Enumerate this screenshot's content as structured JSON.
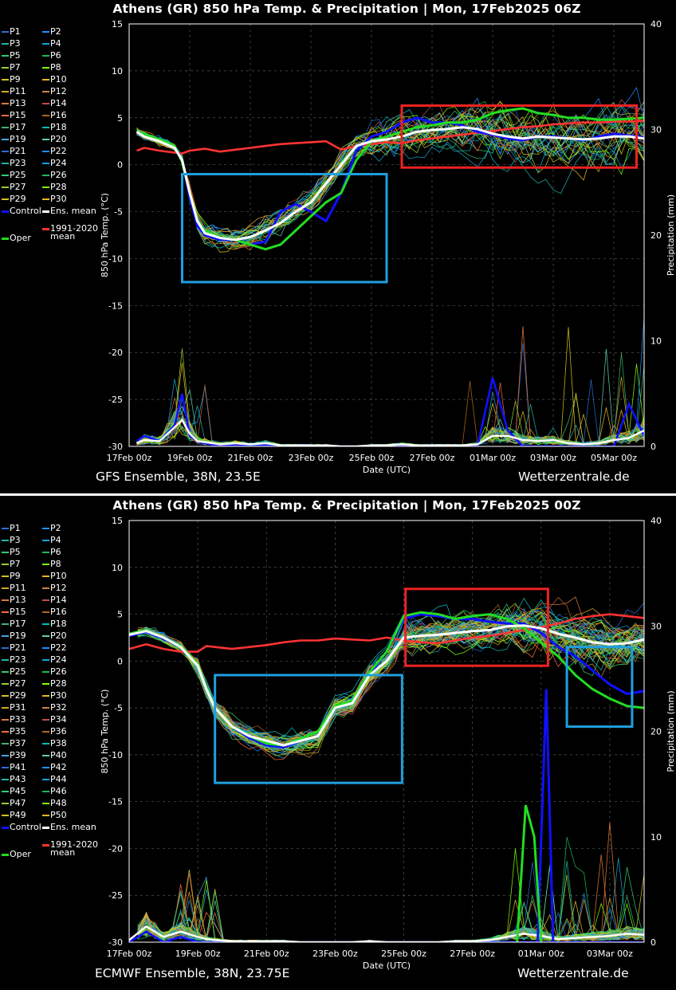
{
  "colors": {
    "control": "#1010ff",
    "ens_mean": "#ffffff",
    "oper": "#22dd22",
    "climate": "#ff3333",
    "box_warm": "#ee2222",
    "box_cold": "#1f9fdf",
    "member_palette": [
      "#2b6cd6",
      "#1e90ff",
      "#20b2aa",
      "#11a5d8",
      "#2ecc71",
      "#1db954",
      "#9acd32",
      "#7fff00",
      "#d4c21a",
      "#e8b520",
      "#daa520",
      "#cd853f",
      "#e07b39",
      "#c0504d",
      "#ff6a3d",
      "#b5651d",
      "#3cb371",
      "#00bfbf",
      "#48a4e0",
      "#66cdaa"
    ]
  },
  "panels": [
    {
      "title": "Athens  (GR)  850 hPa Temp. & Precipitation | Mon, 17Feb2025 06Z",
      "footer_left": "GFS Ensemble, 38N, 23.5E",
      "footer_right": "Wetterzentrale.de",
      "legend": {
        "members": [
          "P1",
          "P2",
          "P3",
          "P4",
          "P5",
          "P6",
          "P7",
          "P8",
          "P9",
          "P10",
          "P11",
          "P12",
          "P13",
          "P14",
          "P15",
          "P16",
          "P17",
          "P18",
          "P19",
          "P20",
          "P21",
          "P22",
          "P23",
          "P24",
          "P25",
          "P26",
          "P27",
          "P28",
          "P29",
          "P30"
        ],
        "control": "Control",
        "ens_mean": "Ens. mean",
        "climate": "1991-2020",
        "climate_2": "mean",
        "oper": "Oper"
      },
      "chart_data": {
        "type": "line",
        "xlabel": "Date (UTC)",
        "ylabel": "850 hPa Temp. (°C)",
        "ylabel_right": "Precipitation (mm)",
        "ylim": [
          -30,
          15
        ],
        "ylim_right": [
          0,
          40
        ],
        "yticks": [
          "15",
          "10",
          "5",
          "0",
          "-5",
          "-10",
          "-15",
          "-20",
          "-25",
          "-30"
        ],
        "yticks_right": [
          "40",
          "30",
          "20",
          "10",
          "0"
        ],
        "xticks": [
          "17Feb 00z",
          "19Feb 00z",
          "21Feb 00z",
          "23Feb 00z",
          "25Feb 00z",
          "27Feb 00z",
          "01Mar 00z",
          "03Mar 00z",
          "05Mar 00z"
        ],
        "xrange_days": [
          0,
          17
        ],
        "members_count": 30,
        "t_days": [
          0.25,
          0.5,
          1,
          1.5,
          1.75,
          2,
          2.25,
          2.5,
          3,
          3.5,
          4,
          4.5,
          5,
          5.5,
          6,
          6.5,
          7,
          7.5,
          8,
          8.5,
          9,
          9.5,
          10,
          10.5,
          11,
          11.5,
          12,
          12.5,
          13,
          13.5,
          14,
          14.5,
          15,
          15.5,
          16,
          16.5,
          17
        ],
        "series": [
          {
            "name": "Ens. mean",
            "values": [
              3.5,
              3,
              2.5,
              1.8,
              0.5,
              -3,
              -6,
              -7.3,
              -7.8,
              -8,
              -7.7,
              -7,
              -6.2,
              -5,
              -4,
              -2,
              0,
              2,
              2.5,
              2.7,
              3,
              3.5,
              3.7,
              3.8,
              4,
              3.8,
              3.3,
              3,
              2.8,
              3,
              2.9,
              2.8,
              2.7,
              2.8,
              3,
              3,
              2.8
            ]
          },
          {
            "name": "Control",
            "values": [
              3.5,
              3.2,
              2.6,
              2,
              0.5,
              -3.5,
              -6.5,
              -7.5,
              -8,
              -8,
              -8.5,
              -8.2,
              -5,
              -4.2,
              -5,
              -6,
              -3,
              1.5,
              3,
              3.5,
              4.5,
              5,
              4.5,
              4.5,
              4.2,
              3.5,
              3.2,
              2.8,
              2.6,
              3,
              3,
              2.8,
              2.6,
              3,
              3.3,
              3.1,
              2.9
            ]
          },
          {
            "name": "Oper",
            "values": [
              3.5,
              3.3,
              2.7,
              2,
              0.3,
              -3,
              -6,
              -7,
              -7.8,
              -8,
              -8.5,
              -9,
              -8.5,
              -7,
              -5.5,
              -4,
              -3,
              0.5,
              2.5,
              3,
              3.5,
              4,
              4.2,
              4.5,
              4.5,
              4.8,
              5.5,
              5.8,
              6,
              5.5,
              5.3,
              5,
              5,
              4.8,
              4.8,
              4.9,
              5
            ]
          },
          {
            "name": "1991-2020 mean",
            "values": [
              1.5,
              1.8,
              1.5,
              1.3,
              1.2,
              1.5,
              1.6,
              1.7,
              1.4,
              1.6,
              1.8,
              2,
              2.2,
              2.3,
              2.4,
              2.5,
              1.6,
              2,
              2.2,
              2.4,
              2.3,
              2.6,
              2.8,
              3,
              3.2,
              3.4,
              3.6,
              3.8,
              4,
              4.1,
              4.3,
              4.4,
              4.5,
              4.5,
              4.6,
              4.6,
              4.7
            ]
          }
        ],
        "precip_mean": [
          0.3,
          0.6,
          0.5,
          1.8,
          2.5,
          1.2,
          0.5,
          0.4,
          0.2,
          0.3,
          0.2,
          0.3,
          0.1,
          0.1,
          0.1,
          0.1,
          0,
          0,
          0.1,
          0.1,
          0.2,
          0.1,
          0.1,
          0.1,
          0.1,
          0.2,
          1,
          1,
          0.6,
          0.5,
          0.6,
          0.3,
          0.2,
          0.3,
          0.6,
          0.8,
          1.5
        ],
        "precip_control": [
          0.5,
          1,
          0.5,
          2,
          5,
          1,
          0.5,
          0.3,
          0,
          0.1,
          0,
          0.1,
          0,
          0,
          0,
          0,
          0,
          0,
          0,
          0,
          0,
          0,
          0,
          0,
          0,
          0,
          6.5,
          1.5,
          0,
          0,
          0,
          0,
          0,
          0,
          0,
          4,
          1
        ],
        "boxes": [
          {
            "kind": "cold",
            "x": [
              1.75,
              8.5
            ],
            "y": [
              -12.5,
              -1
            ]
          },
          {
            "kind": "warm",
            "x": [
              9.0,
              16.75
            ],
            "y": [
              -0.3,
              6.3
            ]
          }
        ]
      }
    },
    {
      "title": "Athens  (GR)  850 hPa Temp. & Precipitation | Mon, 17Feb2025 00Z",
      "footer_left": "ECMWF Ensemble, 38N, 23.75E",
      "footer_right": "Wetterzentrale.de",
      "legend": {
        "members": [
          "P1",
          "P2",
          "P3",
          "P4",
          "P5",
          "P6",
          "P7",
          "P8",
          "P9",
          "P10",
          "P11",
          "P12",
          "P13",
          "P14",
          "P15",
          "P16",
          "P17",
          "P18",
          "P19",
          "P20",
          "P21",
          "P22",
          "P23",
          "P24",
          "P25",
          "P26",
          "P27",
          "P28",
          "P29",
          "P30",
          "P31",
          "P32",
          "P33",
          "P34",
          "P35",
          "P36",
          "P37",
          "P38",
          "P39",
          "P40",
          "P41",
          "P42",
          "P43",
          "P44",
          "P45",
          "P46",
          "P47",
          "P48",
          "P49",
          "P50"
        ],
        "control": "Control",
        "ens_mean": "Ens. mean",
        "climate": "1991-2020",
        "climate_2": "mean",
        "oper": "Oper"
      },
      "chart_data": {
        "type": "line",
        "xlabel": "Date (UTC)",
        "ylabel": "850 hPa Temp. (°C)",
        "ylabel_right": "Precipitation (mm)",
        "ylim": [
          -30,
          15
        ],
        "ylim_right": [
          0,
          40
        ],
        "yticks": [
          "15",
          "10",
          "5",
          "0",
          "-5",
          "-10",
          "-15",
          "-20",
          "-25",
          "-30"
        ],
        "yticks_right": [
          "40",
          "30",
          "20",
          "10",
          "0"
        ],
        "xticks": [
          "17Feb 00z",
          "19Feb 00z",
          "21Feb 00z",
          "23Feb 00z",
          "25Feb 00z",
          "27Feb 00z",
          "01Mar 00z",
          "03Mar 00z"
        ],
        "xrange_days": [
          0,
          15
        ],
        "members_count": 50,
        "t_days": [
          0,
          0.5,
          1,
          1.5,
          2,
          2.25,
          2.5,
          3,
          3.5,
          4,
          4.5,
          5,
          5.5,
          6,
          6.5,
          7,
          7.5,
          8,
          8.5,
          9,
          9.5,
          10,
          10.5,
          11,
          11.5,
          12,
          12.5,
          13,
          13.5,
          14,
          14.5,
          15
        ],
        "series": [
          {
            "name": "Ens. mean",
            "values": [
              2.8,
              3.2,
              2.5,
              1.5,
              -0.5,
              -3,
              -5,
              -7,
              -8,
              -8.5,
              -9,
              -8.5,
              -8,
              -5,
              -4.5,
              -1.5,
              0,
              2.5,
              2.7,
              2.8,
              3,
              3.2,
              3.3,
              3.7,
              3.8,
              3.5,
              2.9,
              2.5,
              2,
              1.8,
              1.9,
              2.3
            ]
          },
          {
            "name": "Control",
            "values": [
              2.7,
              3.1,
              2.4,
              1.5,
              -0.5,
              -3,
              -5,
              -7,
              -8.2,
              -9,
              -9.2,
              -8.5,
              -8,
              -5,
              -4.5,
              -1.5,
              1,
              4.5,
              5,
              4.8,
              4.5,
              4.5,
              4.2,
              4,
              4,
              3,
              1.5,
              0.5,
              -1,
              -2.5,
              -3.5,
              -3.2
            ]
          },
          {
            "name": "Oper",
            "values": [
              2.9,
              3.3,
              2.5,
              1.6,
              -0.3,
              -2.8,
              -5,
              -7,
              -8,
              -8.8,
              -9,
              -8.3,
              -7.5,
              -4.8,
              -4.2,
              -1.2,
              1,
              4.8,
              5.2,
              5,
              4.5,
              4.8,
              5,
              4.5,
              3.5,
              2,
              0.5,
              -1.5,
              -3,
              -4,
              -4.8,
              -5
            ]
          },
          {
            "name": "1991-2020 mean",
            "values": [
              1.3,
              1.8,
              1.3,
              1,
              1,
              1.6,
              1.5,
              1.3,
              1.5,
              1.7,
              2,
              2.2,
              2.2,
              2.4,
              2.3,
              2.2,
              2.5,
              2.2,
              2,
              1.9,
              2.2,
              2.5,
              2.7,
              3,
              3.3,
              3.6,
              4,
              4.5,
              4.8,
              5,
              4.8,
              4.6
            ]
          }
        ],
        "precip_mean": [
          0.2,
          1.5,
          0.5,
          1,
          0.5,
          0.3,
          0.2,
          0.1,
          0.1,
          0.1,
          0.1,
          0,
          0,
          0,
          0,
          0.1,
          0,
          0,
          0,
          0,
          0.1,
          0.1,
          0.2,
          0.5,
          0.8,
          0.6,
          0.3,
          0.4,
          0.5,
          0.6,
          0.8,
          0.7
        ],
        "precip_control": [
          0,
          1,
          0,
          0.5,
          0,
          0,
          0,
          0,
          0,
          0,
          0,
          0,
          0,
          0,
          0,
          0,
          0,
          0,
          0,
          0,
          0,
          0,
          0,
          0,
          0,
          0,
          0,
          0,
          0,
          0,
          0,
          0
        ],
        "precip_spike": {
          "control_peak": 24,
          "oper_peak": 13
        },
        "boxes": [
          {
            "kind": "cold",
            "x": [
              2.5,
              7.95
            ],
            "y": [
              -13,
              -1.5
            ]
          },
          {
            "kind": "warm",
            "x": [
              8.05,
              12.2
            ],
            "y": [
              -0.5,
              7.7
            ]
          },
          {
            "kind": "cold",
            "x": [
              12.75,
              14.65
            ],
            "y": [
              -7,
              1.5
            ]
          }
        ]
      }
    }
  ]
}
